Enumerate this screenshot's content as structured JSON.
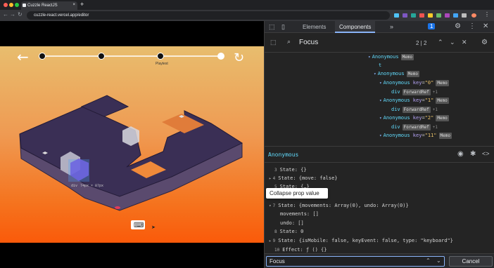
{
  "browser": {
    "tab_title": "Cuzzle ReactJS",
    "tab_close": "×",
    "new_tab": "+",
    "url": "cuzzle-react.vercel.app/editor",
    "back": "←",
    "forward": "→",
    "reload": "↻"
  },
  "game": {
    "back_icon": "←",
    "reload_icon": "↻",
    "progress_label": "Playtest",
    "inspect_tag": "div",
    "inspect_size": "74px × 87px",
    "keyboard_icon": "⌨"
  },
  "devtools": {
    "tabs": [
      "Elements",
      "Components"
    ],
    "more": "»",
    "notif_count": "1",
    "search_value": "Focus",
    "search_count": "2 | 2",
    "tree": [
      {
        "name": "Anonymous",
        "badge": "Memo",
        "indent": 0,
        "arrow": "▾"
      },
      {
        "name": "t",
        "indent": 1,
        "arrow": ""
      },
      {
        "name": "Anonymous",
        "badge": "Memo",
        "indent": 1,
        "arrow": "▾"
      },
      {
        "name": "Anonymous",
        "key": "key",
        "keyval": "\"0\"",
        "badge": "Memo",
        "indent": 2,
        "arrow": "▾"
      },
      {
        "name": "div",
        "badge": "ForwardRef",
        "plus": "+1",
        "indent": 3,
        "arrow": ""
      },
      {
        "name": "Anonymous",
        "key": "key",
        "keyval": "\"1\"",
        "badge": "Memo",
        "indent": 2,
        "arrow": "▾"
      },
      {
        "name": "div",
        "badge": "ForwardRef",
        "plus": "+1",
        "indent": 3,
        "arrow": ""
      },
      {
        "name": "Anonymous",
        "key": "key",
        "keyval": "\"2\"",
        "badge": "Memo",
        "indent": 2,
        "arrow": "▾"
      },
      {
        "name": "div",
        "badge": "ForwardRef",
        "plus": "+1",
        "indent": 3,
        "arrow": ""
      },
      {
        "name": "Anonymous",
        "key": "key",
        "keyval": "\"11\"",
        "badge": "Memo",
        "indent": 2,
        "arrow": "▾"
      }
    ],
    "selected_component": "Anonymous",
    "props": [
      {
        "idx": "3",
        "text": "State: {}",
        "arrow": "",
        "indent": 0
      },
      {
        "idx": "4",
        "text": "State: {move: false}",
        "arrow": "▸",
        "indent": 0
      },
      {
        "idx": "5",
        "text": "State: {…}",
        "arrow": "",
        "indent": 0
      },
      {
        "idx": "7",
        "text": "State: {movements: Array(0), undo: Array(0)}",
        "arrow": "▾",
        "indent": 0
      },
      {
        "idx": "",
        "text": "movements: []",
        "arrow": "",
        "indent": 1
      },
      {
        "idx": "",
        "text": "undo: []",
        "arrow": "",
        "indent": 1
      },
      {
        "idx": "8",
        "text": "State: 0",
        "arrow": "",
        "indent": 0
      },
      {
        "idx": "9",
        "text": "State: {isMobile: false, keyEvent: false, type: \"keyboard\"}",
        "arrow": "▸",
        "indent": 0
      },
      {
        "idx": "10",
        "text": "Effect: ƒ () {}",
        "arrow": "",
        "indent": 0
      }
    ],
    "tooltip": "Collapse prop value",
    "find_value": "Focus",
    "cancel_label": "Cancel"
  }
}
